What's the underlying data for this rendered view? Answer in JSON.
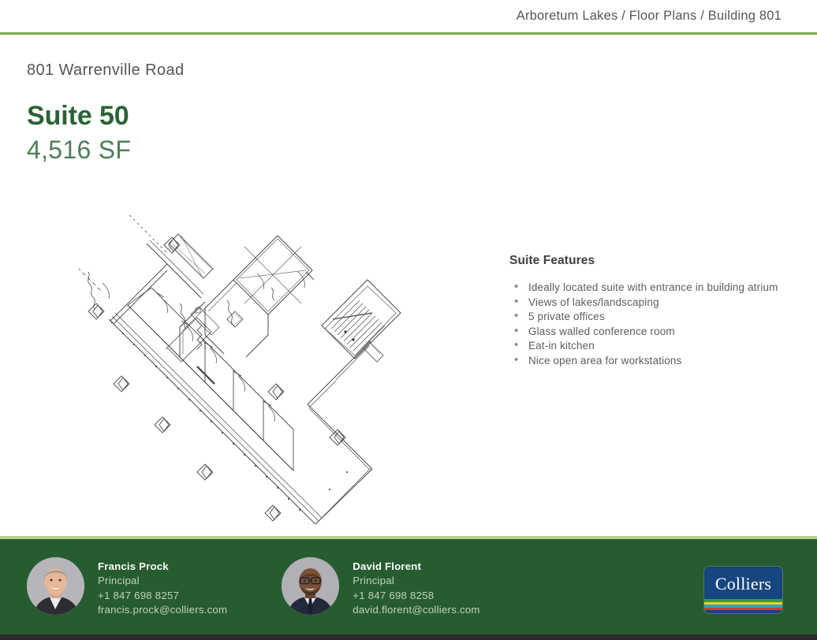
{
  "header": {
    "breadcrumb": "Arboretum Lakes / Floor Plans / Building 801",
    "rule_color": "#7ea84e"
  },
  "title_block": {
    "address": "801 Warrenville Road",
    "suite_name": "Suite 50",
    "suite_size": "4,516 SF",
    "suite_name_color": "#2a6334",
    "suite_size_color": "#4e7f58"
  },
  "floorplan": {
    "alt": "Suite 50 architectural floor plan, rotated approximately 45 degrees, showing private offices along the south wall, an elevator core, stairwell, and open workstation area.",
    "line_color": "#4a4a4a"
  },
  "features": {
    "title": "Suite Features",
    "items": [
      "Ideally located suite with entrance in building atrium",
      "Views of lakes/landscaping",
      "5 private offices",
      "Glass walled conference room",
      "Eat-in kitchen",
      "Nice open area for workstations"
    ]
  },
  "footer": {
    "background_color": "#265c2f",
    "accent_color": "#b9d18c",
    "contacts": [
      {
        "name": "Francis Prock",
        "title": "Principal",
        "phone": "+1 847 698 8257",
        "email": "francis.prock@colliers.com"
      },
      {
        "name": "David Florent",
        "title": "Principal",
        "phone": "+1 847 698 8258",
        "email": "david.florent@colliers.com"
      }
    ],
    "logo": {
      "text": "Colliers",
      "box_color": "#17457f",
      "stripe_colors": [
        "#3f9443",
        "#f2d21c",
        "#2aa5c9",
        "#d23b30"
      ]
    }
  }
}
